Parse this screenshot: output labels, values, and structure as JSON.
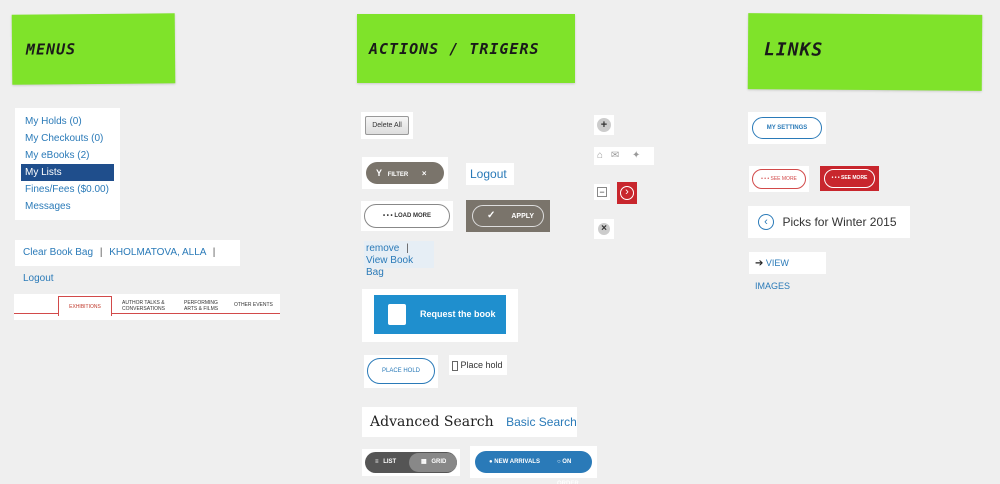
{
  "notes": {
    "menus": "MENUS",
    "actions": "ACTIONS / TRIGERS",
    "links": "LINKS"
  },
  "menu": {
    "items": [
      "My Holds (0)",
      "My Checkouts (0)",
      "My eBooks (2)",
      "My Lists",
      "Fines/Fees ($0.00)",
      "Messages"
    ],
    "active_index": 3
  },
  "bookbag": {
    "clear": "Clear Book Bag",
    "user": "KHOLMATOVA, ALLA",
    "logout": "Logout",
    "sep": "|"
  },
  "tabs": {
    "exhibitions": "EXHIBITIONS",
    "author_talks_1": "AUTHOR TALKS &",
    "author_talks_2": "CONVERSATIONS",
    "performing_1": "PERFORMING",
    "performing_2": "ARTS & FILMS",
    "other": "OTHER EVENTS"
  },
  "actions": {
    "delete_all": "Delete All",
    "filter": "FILTER",
    "filter_close": "×",
    "logout": "Logout",
    "load_more": "• • • LOAD MORE",
    "apply": "APPLY",
    "remove": "remove",
    "remove_sep": "|",
    "view_book_bag": "View Book Bag",
    "request_book": "Request the book",
    "place_hold_button": "PLACE HOLD",
    "place_hold_link": "Place hold",
    "advanced_search": "Advanced Search",
    "basic_search": "Basic Search",
    "list": "LIST",
    "grid": "GRID",
    "new_arrivals": "NEW ARRIVALS",
    "on_order": "ON ORDER"
  },
  "icons_col": {
    "plus": "+",
    "minus": "−",
    "close": "×",
    "chevron": "›",
    "mail": "✉",
    "gear": "✦"
  },
  "links": {
    "my_settings": "MY SETTINGS",
    "see_more_1": "• • • SEE MORE",
    "see_more_2": "• • • SEE MORE",
    "picks_chevron": "‹",
    "picks": "Picks for Winter 2015",
    "view_arrow": "➔",
    "view_images": "VIEW IMAGES"
  },
  "colors": {
    "sticky_green": "#7fe32a",
    "link_blue": "#2a7ab8",
    "active_blue": "#1f4e8c",
    "red": "#c8262d",
    "gray_btn": "#7a746b"
  }
}
